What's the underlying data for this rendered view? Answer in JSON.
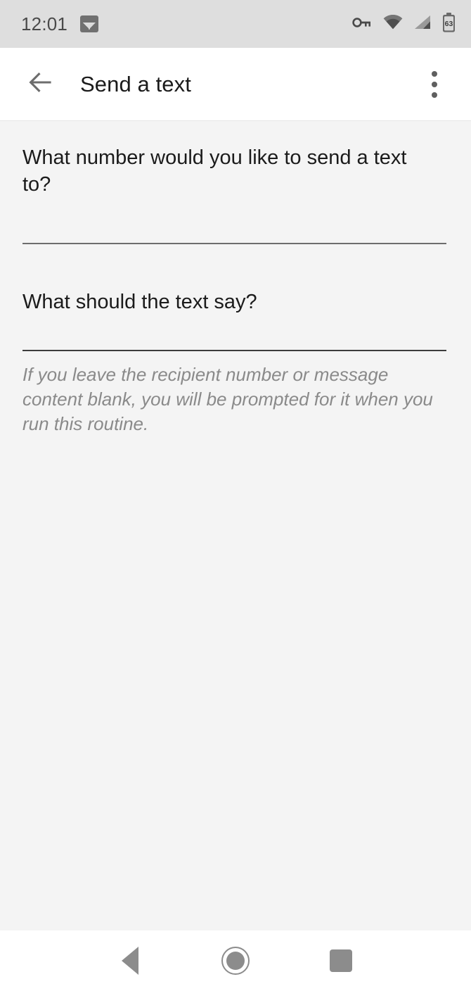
{
  "status_bar": {
    "time": "12:01",
    "notification_icons": [
      "photo-icon"
    ],
    "system_icons": [
      "vpn-key-icon",
      "wifi-icon",
      "cellular-signal-icon",
      "battery-icon"
    ],
    "battery_level": "63"
  },
  "app_bar": {
    "title": "Send a text",
    "back_label": "Navigate up",
    "overflow_label": "More options"
  },
  "form": {
    "fields": [
      {
        "label": "What number would you like to send a text to?",
        "value": "",
        "placeholder": ""
      },
      {
        "label": "What should the text say?",
        "value": "",
        "placeholder": ""
      }
    ],
    "helper_text": "If you leave the recipient number or message content blank, you will be prompted for it when you run this routine."
  },
  "nav_bar": {
    "back": "Back",
    "home": "Home",
    "recents": "Recent apps"
  },
  "colors": {
    "status_bar_bg": "#dedede",
    "app_bar_bg": "#ffffff",
    "content_bg": "#f4f4f4",
    "nav_bar_bg": "#ffffff",
    "text_primary": "#1b1b1b",
    "text_hint": "#8a8a8a",
    "icon_gray": "#8c8c8c",
    "underline": "#6d6d6d"
  }
}
